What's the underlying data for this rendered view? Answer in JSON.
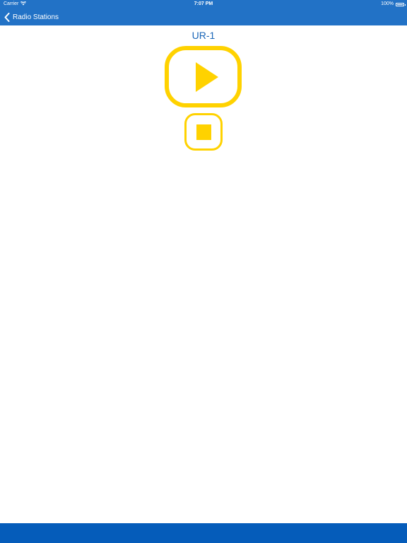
{
  "status_bar": {
    "carrier": "Carrier",
    "time": "7:07 PM",
    "battery": "100%",
    "wifi_icon": "wifi-icon",
    "battery_icon": "battery-full-icon"
  },
  "nav": {
    "back_label": "Radio Stations",
    "back_icon": "chevron-left-icon"
  },
  "player": {
    "station_name": "UR-1",
    "play_icon": "play-icon",
    "stop_icon": "stop-icon"
  },
  "colors": {
    "nav_background": "#2272c6",
    "bottom_bar": "#055cba",
    "accent_yellow": "#ffd200",
    "title_blue": "#1a66b8"
  }
}
